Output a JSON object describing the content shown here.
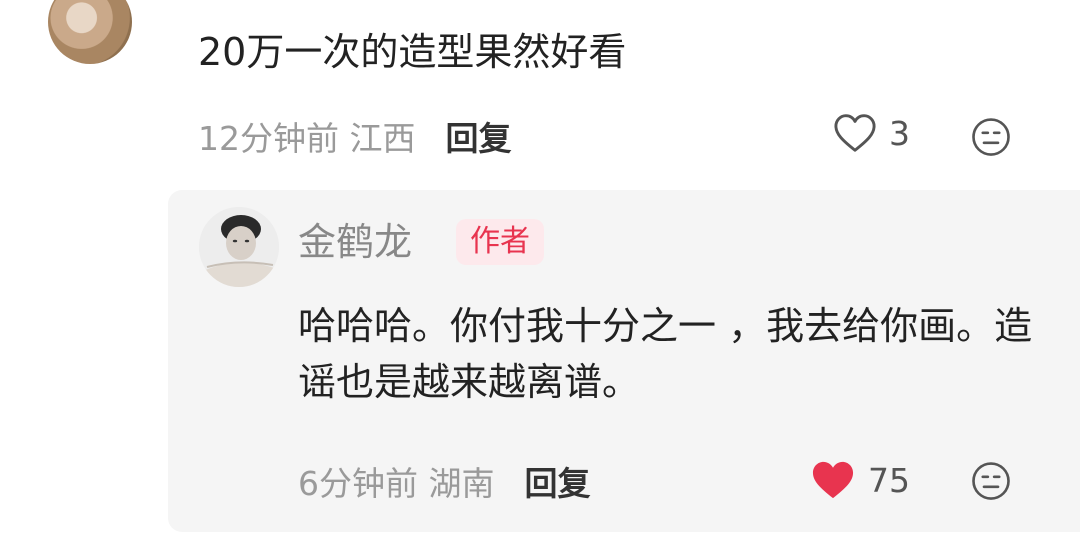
{
  "comment": {
    "text": "20万一次的造型果然好看",
    "time_location": "12分钟前 江西",
    "reply_label": "回复",
    "like_count": "3",
    "liked": false
  },
  "reply": {
    "author": "金鹤龙",
    "badge": "作者",
    "text": "哈哈哈。你付我十分之一 ，我去给你画。造谣也是越来越离谱。",
    "time_location": "6分钟前 湖南",
    "reply_label": "回复",
    "like_count": "75",
    "liked": true
  },
  "colors": {
    "liked_heart": "#e8344f",
    "badge_bg": "#fde9ec",
    "badge_text": "#e8344f",
    "card_bg": "#f5f5f5"
  }
}
